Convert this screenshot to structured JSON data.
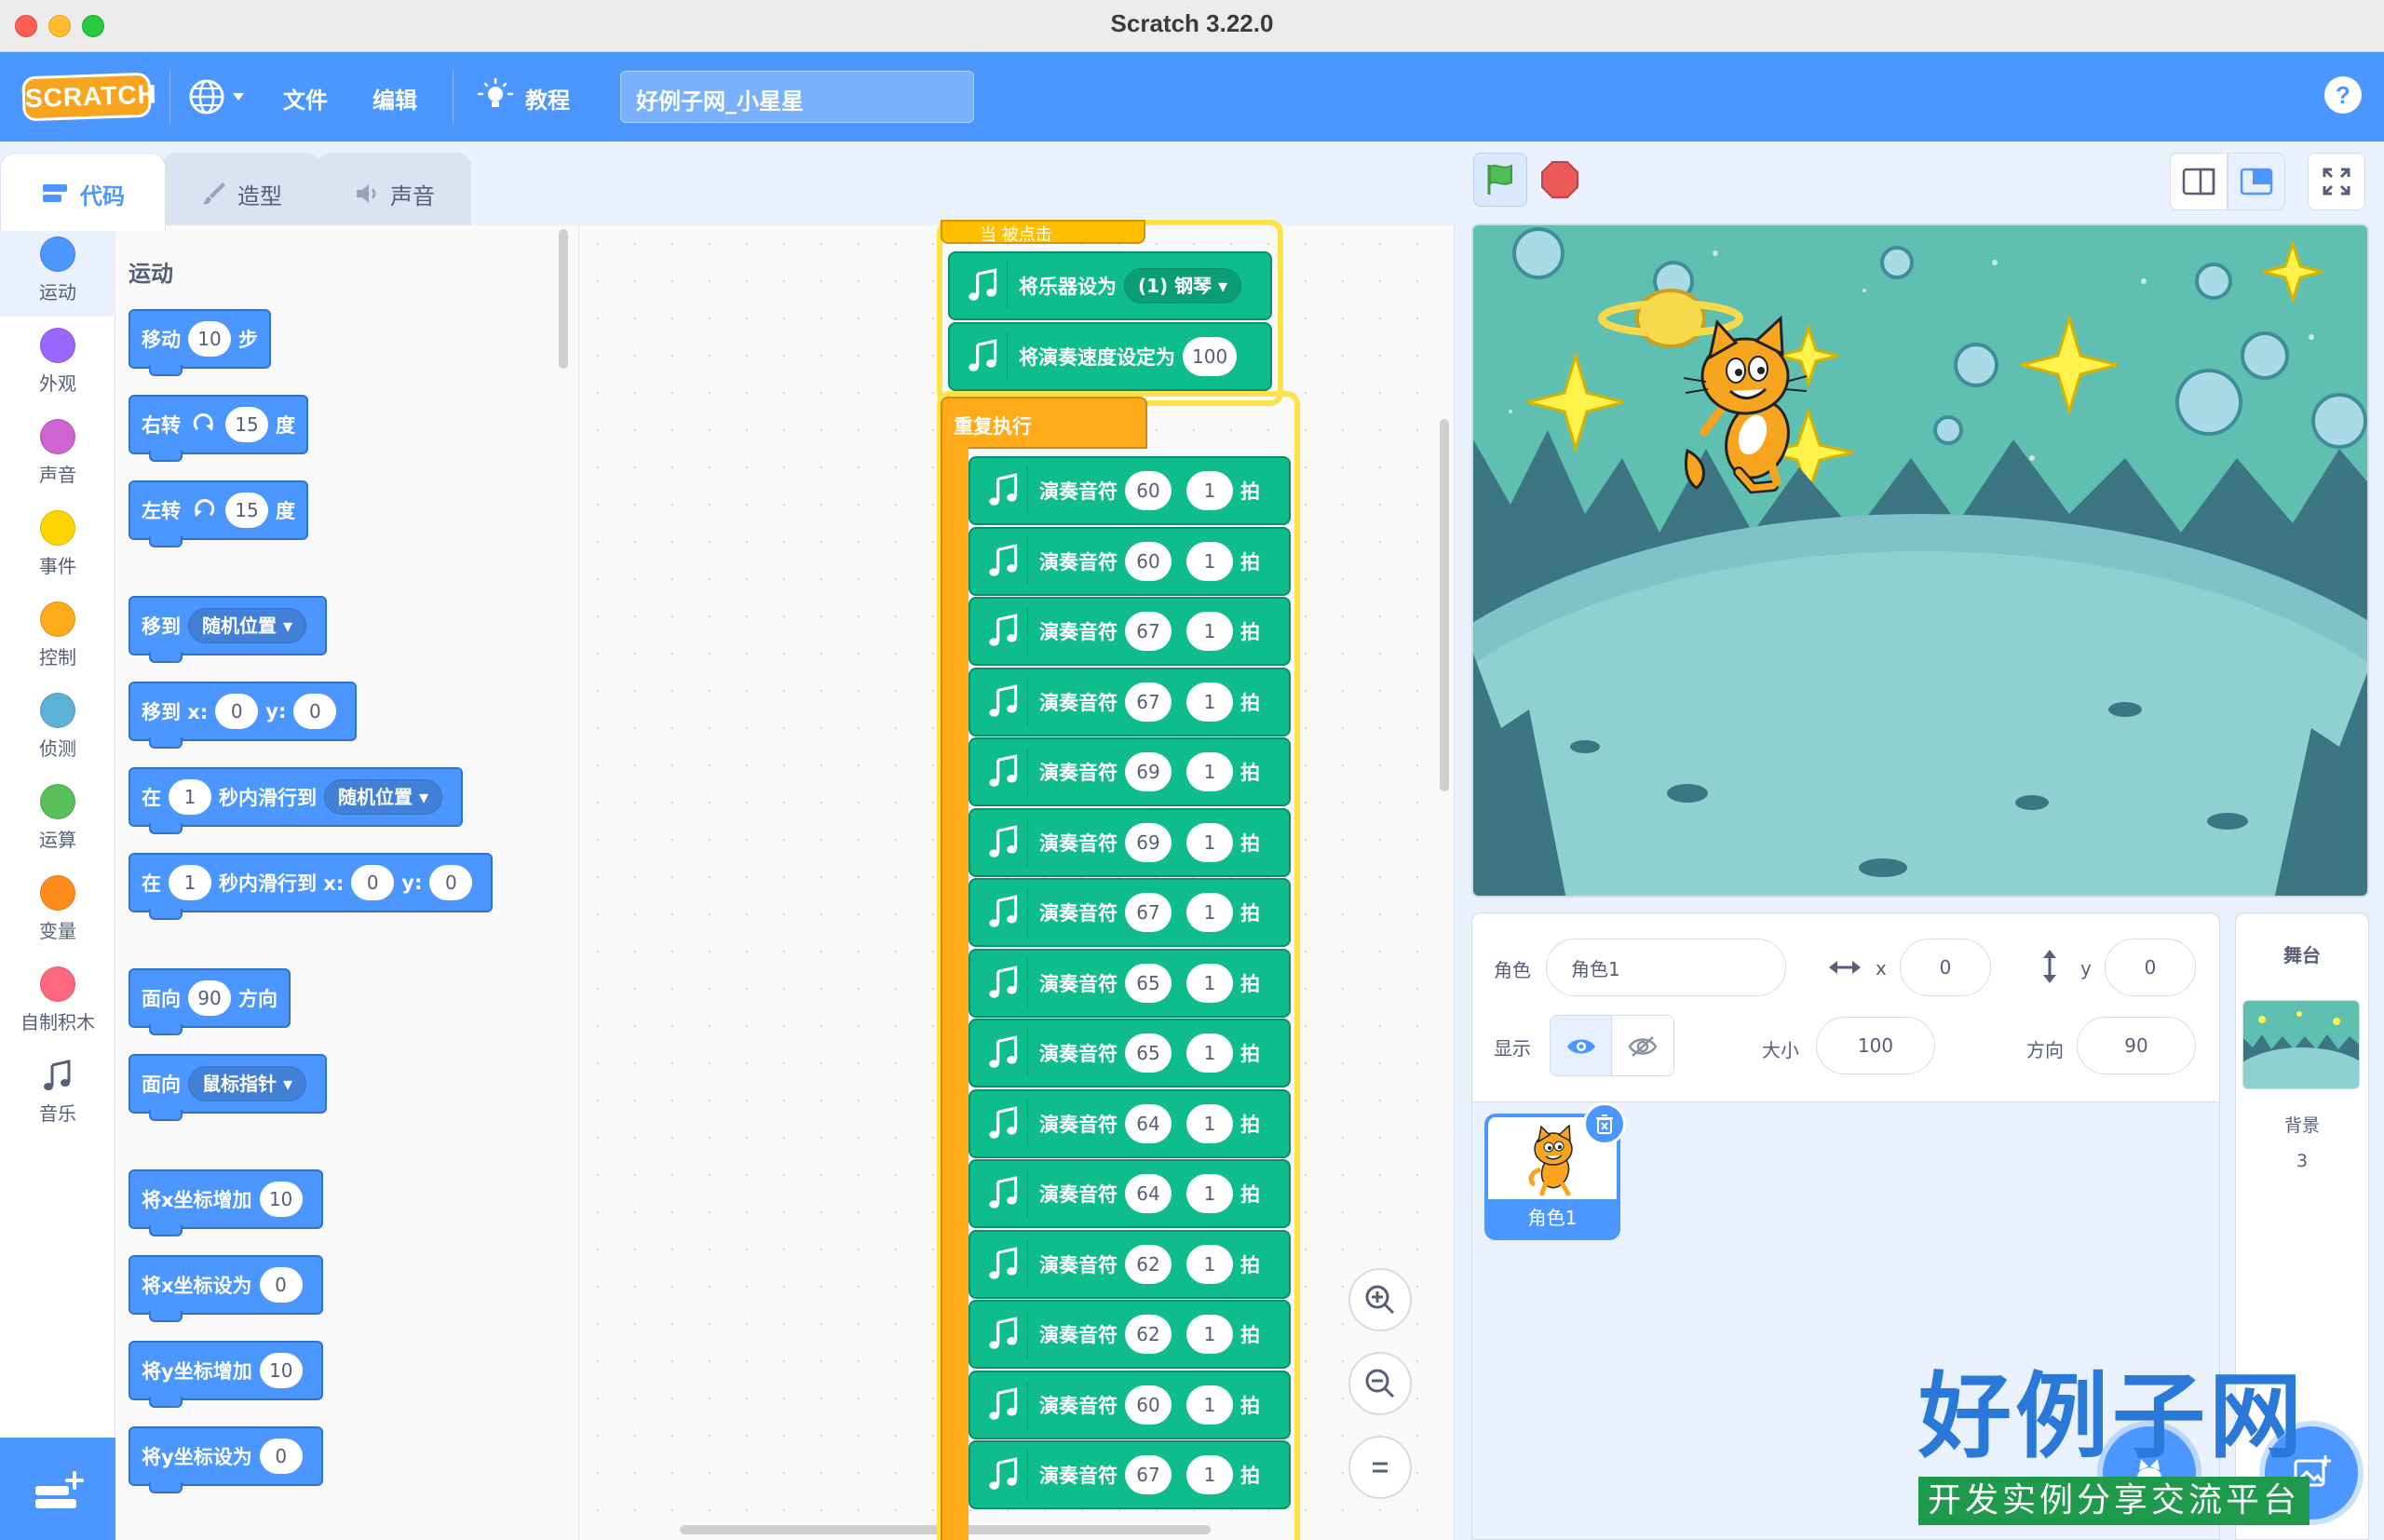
{
  "window": {
    "title": "Scratch 3.22.0"
  },
  "menubar": {
    "logo": "SCRATCH",
    "file": "文件",
    "edit": "编辑",
    "tutorials": "教程",
    "project_title": "好例子网_小星星",
    "help": "?"
  },
  "tabs": [
    {
      "label": "代码"
    },
    {
      "label": "造型"
    },
    {
      "label": "声音"
    }
  ],
  "categories": [
    {
      "label": "运动",
      "color": "#4c97ff"
    },
    {
      "label": "外观",
      "color": "#9966ff"
    },
    {
      "label": "声音",
      "color": "#cf63cf"
    },
    {
      "label": "事件",
      "color": "#ffd500"
    },
    {
      "label": "控制",
      "color": "#ffab19"
    },
    {
      "label": "侦测",
      "color": "#5cb1d6"
    },
    {
      "label": "运算",
      "color": "#59c059"
    },
    {
      "label": "变量",
      "color": "#ff8c1a"
    },
    {
      "label": "自制积木",
      "color": "#ff6680"
    },
    {
      "label": "音乐",
      "color": "#0fbd8c"
    }
  ],
  "palette": {
    "section": "运动",
    "blocks": {
      "move": {
        "a": "移动",
        "v": "10",
        "b": "步"
      },
      "turn_right": {
        "a": "右转",
        "v": "15",
        "b": "度"
      },
      "turn_left": {
        "a": "左转",
        "v": "15",
        "b": "度"
      },
      "goto": {
        "a": "移到",
        "drop": "随机位置"
      },
      "goto_xy": {
        "a": "移到 x:",
        "x": "0",
        "b": "y:",
        "y": "0"
      },
      "glide_to": {
        "a": "在",
        "v": "1",
        "b": "秒内滑行到",
        "drop": "随机位置"
      },
      "glide_xy": {
        "a": "在",
        "v": "1",
        "b": "秒内滑行到 x:",
        "x": "0",
        "c": "y:",
        "y": "0"
      },
      "point_dir": {
        "a": "面向",
        "v": "90",
        "b": "方向"
      },
      "point_towards": {
        "a": "面向",
        "drop": "鼠标指针"
      },
      "change_x": {
        "a": "将x坐标增加",
        "v": "10"
      },
      "set_x": {
        "a": "将x坐标设为",
        "v": "0"
      },
      "change_y": {
        "a": "将y坐标增加",
        "v": "10"
      },
      "set_y": {
        "a": "将y坐标设为",
        "v": "0"
      }
    }
  },
  "script": {
    "hat_partial": "当 被点击",
    "set_instrument": {
      "label": "将乐器设为",
      "value": "(1) 钢琴"
    },
    "set_tempo": {
      "label": "将演奏速度设定为",
      "value": "100"
    },
    "repeat_label": "重复执行",
    "note_label": "演奏音符",
    "beat_label": "拍",
    "notes": [
      {
        "note": "60",
        "beats": "1"
      },
      {
        "note": "60",
        "beats": "1"
      },
      {
        "note": "67",
        "beats": "1"
      },
      {
        "note": "67",
        "beats": "1"
      },
      {
        "note": "69",
        "beats": "1"
      },
      {
        "note": "69",
        "beats": "1"
      },
      {
        "note": "67",
        "beats": "1"
      },
      {
        "note": "65",
        "beats": "1"
      },
      {
        "note": "65",
        "beats": "1"
      },
      {
        "note": "64",
        "beats": "1"
      },
      {
        "note": "64",
        "beats": "1"
      },
      {
        "note": "62",
        "beats": "1"
      },
      {
        "note": "62",
        "beats": "1"
      },
      {
        "note": "60",
        "beats": "1"
      },
      {
        "note": "67",
        "beats": "1"
      }
    ]
  },
  "sprite_info": {
    "sprite_label": "角色",
    "sprite_name": "角色1",
    "x_label": "x",
    "x": "0",
    "y_label": "y",
    "y": "0",
    "show_label": "显示",
    "size_label": "大小",
    "size": "100",
    "direction_label": "方向",
    "direction": "90"
  },
  "sprites": [
    {
      "name": "角色1"
    }
  ],
  "stage_panel": {
    "title": "舞台",
    "backdrops_label": "背景",
    "backdrops_count": "3"
  },
  "watermark": {
    "title": "好例子网",
    "subtitle": "开发实例分享交流平台"
  }
}
